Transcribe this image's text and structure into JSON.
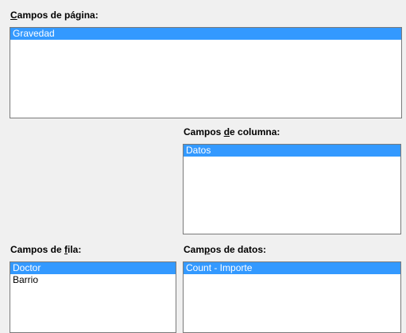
{
  "page_fields": {
    "label_pre": "",
    "label_key": "C",
    "label_post": "ampos de página:",
    "items": [
      "Gravedad"
    ]
  },
  "column_fields": {
    "label_pre": "Campos ",
    "label_key": "d",
    "label_post": "e columna:",
    "items": [
      "Datos"
    ]
  },
  "row_fields": {
    "label_pre": "Campos de ",
    "label_key": "f",
    "label_post": "ila:",
    "items": [
      "Doctor",
      "Barrio"
    ]
  },
  "data_fields": {
    "label_pre": "Cam",
    "label_key": "p",
    "label_post": "os de datos:",
    "items": [
      "Count - Importe"
    ]
  },
  "colors": {
    "selection": "#3399ff",
    "dialog_background": "#f0f0f0"
  }
}
